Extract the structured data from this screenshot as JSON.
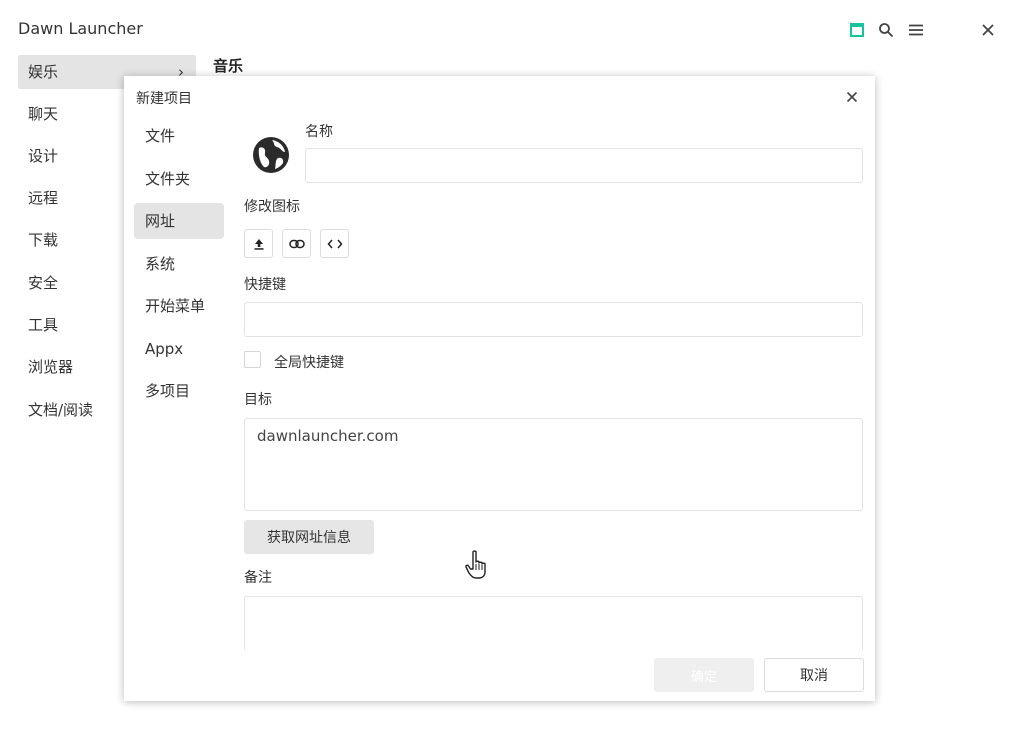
{
  "app": {
    "title": "Dawn Launcher"
  },
  "window_controls": {
    "accent_color": "#16c39a",
    "icons": [
      "layout-icon",
      "search-icon",
      "menu-icon",
      "close-icon"
    ]
  },
  "sidebar": {
    "items": [
      {
        "label": "娱乐",
        "active": true
      },
      {
        "label": "聊天"
      },
      {
        "label": "设计"
      },
      {
        "label": "远程"
      },
      {
        "label": "下载"
      },
      {
        "label": "安全"
      },
      {
        "label": "工具"
      },
      {
        "label": "浏览器"
      },
      {
        "label": "文档/阅读"
      }
    ],
    "chevron": "›"
  },
  "main": {
    "title": "音乐"
  },
  "dialog": {
    "title": "新建项目",
    "types": [
      {
        "label": "文件"
      },
      {
        "label": "文件夹"
      },
      {
        "label": "网址",
        "active": true
      },
      {
        "label": "系统"
      },
      {
        "label": "开始菜单"
      },
      {
        "label": "Appx"
      },
      {
        "label": "多项目"
      }
    ],
    "form": {
      "icon": "globe-icon",
      "name_label": "名称",
      "name_value": "",
      "change_icon_label": "修改图标",
      "icon_buttons": [
        "upload-icon",
        "link-icon",
        "code-icon"
      ],
      "shortcut_label": "快捷键",
      "shortcut_value": "",
      "global_shortcut_label": "全局快捷键",
      "global_shortcut_checked": false,
      "target_label": "目标",
      "target_value": "dawnlauncher.com",
      "fetch_button_label": "获取网址信息",
      "remark_label": "备注",
      "remark_value": ""
    },
    "buttons": {
      "ok": "确定",
      "cancel": "取消"
    }
  }
}
